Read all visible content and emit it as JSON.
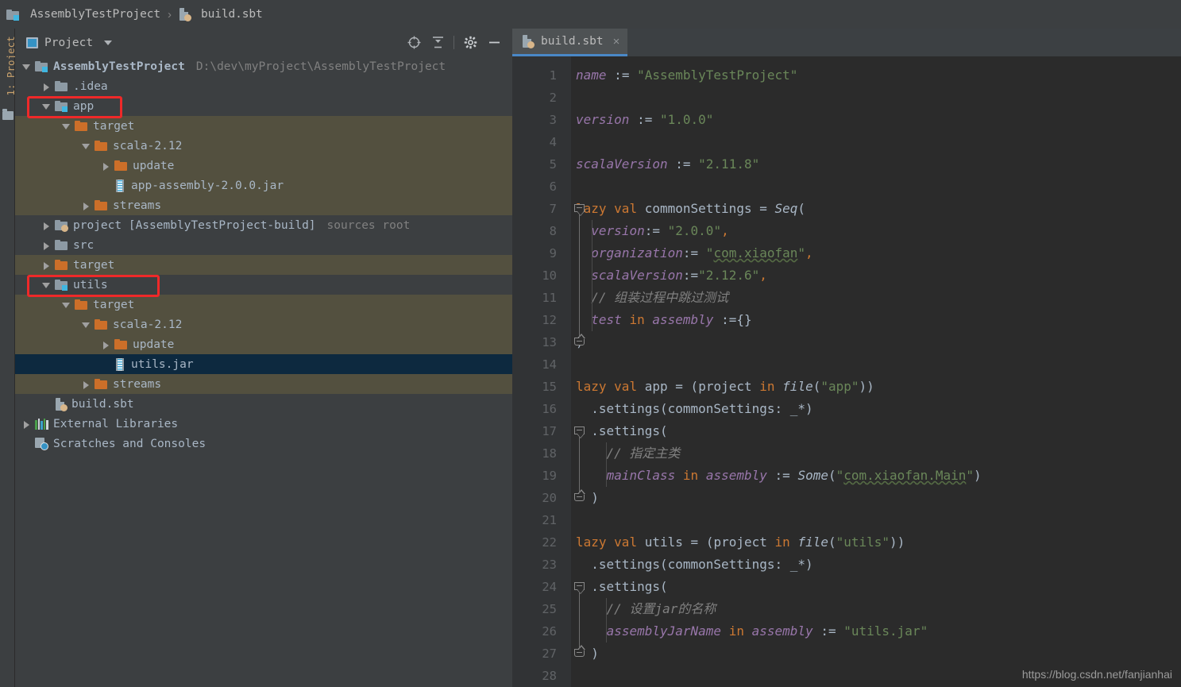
{
  "breadcrumb": {
    "items": [
      {
        "label": "AssemblyTestProject",
        "icon": "module-folder-icon"
      },
      {
        "label": "build.sbt",
        "icon": "sbt-file-icon"
      }
    ],
    "separator": "›"
  },
  "tool_strip": {
    "project_label": "1: Project"
  },
  "project_panel": {
    "title": "Project",
    "actions": [
      {
        "name": "locate-icon",
        "tooltip": "Select Opened File"
      },
      {
        "name": "collapse-all-icon",
        "tooltip": "Collapse All"
      },
      {
        "name": "gear-icon",
        "tooltip": "Settings"
      },
      {
        "name": "minimize-icon",
        "tooltip": "Hide"
      }
    ],
    "tree": [
      {
        "label": "AssemblyTestProject",
        "secondary": "D:\\dev\\myProject\\AssemblyTestProject",
        "icon": "module-folder-icon",
        "arrow": "down",
        "indent": 0,
        "state": "normal",
        "bold": true
      },
      {
        "label": ".idea",
        "secondary": "",
        "icon": "folder-icon",
        "arrow": "right",
        "indent": 1,
        "state": "normal",
        "bold": false
      },
      {
        "label": "app",
        "secondary": "",
        "icon": "module-folder-icon",
        "arrow": "down",
        "indent": 1,
        "state": "normal",
        "bold": false,
        "highlight": true
      },
      {
        "label": "target",
        "secondary": "",
        "icon": "folder-orange-icon",
        "arrow": "down",
        "indent": 2,
        "state": "excluded",
        "bold": false
      },
      {
        "label": "scala-2.12",
        "secondary": "",
        "icon": "folder-orange-icon",
        "arrow": "down",
        "indent": 3,
        "state": "excluded",
        "bold": false
      },
      {
        "label": "update",
        "secondary": "",
        "icon": "folder-orange-icon",
        "arrow": "right",
        "indent": 4,
        "state": "excluded",
        "bold": false
      },
      {
        "label": "app-assembly-2.0.0.jar",
        "secondary": "",
        "icon": "jar-icon",
        "arrow": "none",
        "indent": 4,
        "state": "excluded",
        "bold": false
      },
      {
        "label": "streams",
        "secondary": "",
        "icon": "folder-orange-icon",
        "arrow": "right",
        "indent": 3,
        "state": "excluded",
        "bold": false
      },
      {
        "label": "project [AssemblyTestProject-build]",
        "secondary": "sources root",
        "icon": "module-sbt-icon",
        "arrow": "right",
        "indent": 1,
        "state": "normal",
        "bold": false
      },
      {
        "label": "src",
        "secondary": "",
        "icon": "folder-icon",
        "arrow": "right",
        "indent": 1,
        "state": "normal",
        "bold": false
      },
      {
        "label": "target",
        "secondary": "",
        "icon": "folder-orange-icon",
        "arrow": "right",
        "indent": 1,
        "state": "excluded",
        "bold": false
      },
      {
        "label": "utils",
        "secondary": "",
        "icon": "module-folder-icon",
        "arrow": "down",
        "indent": 1,
        "state": "normal",
        "bold": false,
        "highlight": true
      },
      {
        "label": "target",
        "secondary": "",
        "icon": "folder-orange-icon",
        "arrow": "down",
        "indent": 2,
        "state": "excluded",
        "bold": false
      },
      {
        "label": "scala-2.12",
        "secondary": "",
        "icon": "folder-orange-icon",
        "arrow": "down",
        "indent": 3,
        "state": "excluded",
        "bold": false
      },
      {
        "label": "update",
        "secondary": "",
        "icon": "folder-orange-icon",
        "arrow": "right",
        "indent": 4,
        "state": "excluded",
        "bold": false
      },
      {
        "label": "utils.jar",
        "secondary": "",
        "icon": "jar-icon",
        "arrow": "none",
        "indent": 4,
        "state": "selected",
        "bold": false
      },
      {
        "label": "streams",
        "secondary": "",
        "icon": "folder-orange-icon",
        "arrow": "right",
        "indent": 3,
        "state": "excluded",
        "bold": false
      },
      {
        "label": "build.sbt",
        "secondary": "",
        "icon": "sbt-file-icon",
        "arrow": "none",
        "indent": 1,
        "state": "normal",
        "bold": false
      },
      {
        "label": "External Libraries",
        "secondary": "",
        "icon": "libraries-icon",
        "arrow": "right",
        "indent": 0,
        "state": "normal",
        "bold": false
      },
      {
        "label": "Scratches and Consoles",
        "secondary": "",
        "icon": "scratches-icon",
        "arrow": "none",
        "indent": 0,
        "state": "normal",
        "bold": false
      }
    ]
  },
  "editor": {
    "tabs": [
      {
        "label": "build.sbt",
        "icon": "sbt-file-icon",
        "close": "×",
        "active": true
      }
    ],
    "file_name": "build.sbt",
    "language": "sbt",
    "first_line": 1,
    "last_line": 28,
    "lines": [
      {
        "n": 1,
        "text": "name := \"AssemblyTestProject\""
      },
      {
        "n": 2,
        "text": ""
      },
      {
        "n": 3,
        "text": "version := \"1.0.0\""
      },
      {
        "n": 4,
        "text": ""
      },
      {
        "n": 5,
        "text": "scalaVersion := \"2.11.8\""
      },
      {
        "n": 6,
        "text": ""
      },
      {
        "n": 7,
        "text": "lazy val commonSettings = Seq(",
        "fold": "open"
      },
      {
        "n": 8,
        "text": "  version:= \"2.0.0\","
      },
      {
        "n": 9,
        "text": "  organization:= \"com.xiaofan\","
      },
      {
        "n": 10,
        "text": "  scalaVersion:=\"2.12.6\","
      },
      {
        "n": 11,
        "text": "  // 组装过程中跳过测试"
      },
      {
        "n": 12,
        "text": "  test in assembly :={}"
      },
      {
        "n": 13,
        "text": ")",
        "fold": "close"
      },
      {
        "n": 14,
        "text": ""
      },
      {
        "n": 15,
        "text": "lazy val app = (project in file(\"app\"))"
      },
      {
        "n": 16,
        "text": "  .settings(commonSettings: _*)"
      },
      {
        "n": 17,
        "text": "  .settings(",
        "fold": "open"
      },
      {
        "n": 18,
        "text": "    // 指定主类"
      },
      {
        "n": 19,
        "text": "    mainClass in assembly := Some(\"com.xiaofan.Main\")"
      },
      {
        "n": 20,
        "text": "  )",
        "fold": "close"
      },
      {
        "n": 21,
        "text": ""
      },
      {
        "n": 22,
        "text": "lazy val utils = (project in file(\"utils\"))"
      },
      {
        "n": 23,
        "text": "  .settings(commonSettings: _*)"
      },
      {
        "n": 24,
        "text": "  .settings(",
        "fold": "open"
      },
      {
        "n": 25,
        "text": "    // 设置jar的名称"
      },
      {
        "n": 26,
        "text": "    assemblyJarName in assembly := \"utils.jar\""
      },
      {
        "n": 27,
        "text": "  )",
        "fold": "close"
      },
      {
        "n": 28,
        "text": ""
      }
    ]
  },
  "watermark": {
    "text": "https://blog.csdn.net/fanjianhai"
  },
  "colors": {
    "panel_bg": "#3c3f41",
    "editor_bg": "#2b2b2b",
    "gutter_bg": "#313335",
    "excluded_row": "#53503f",
    "selected_row": "#0d293f",
    "accent_blue": "#4a88c7",
    "annotation_red": "#ef2929",
    "keyword": "#cc7832",
    "string": "#6a8759",
    "identifier": "#9876aa",
    "comment": "#808080",
    "text": "#a9b7c6"
  },
  "annotations": [
    {
      "name": "app-module-highlight",
      "target": "app"
    },
    {
      "name": "utils-module-highlight",
      "target": "utils"
    }
  ]
}
